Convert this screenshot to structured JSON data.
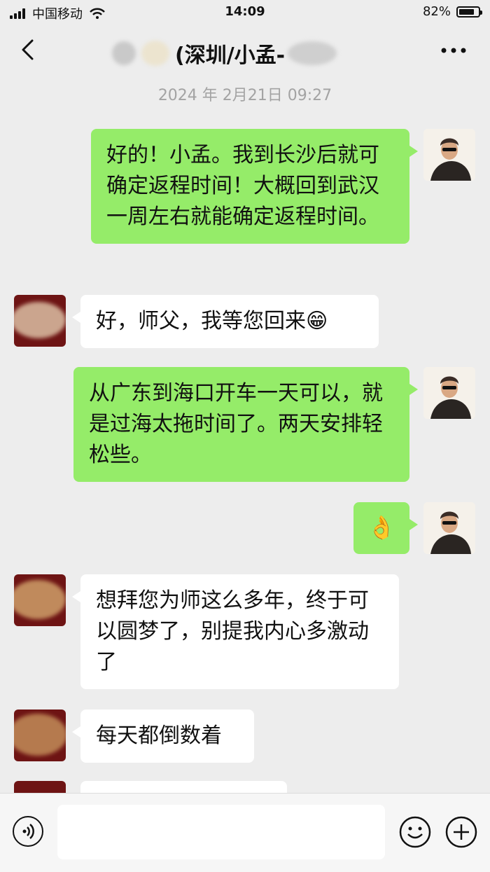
{
  "status": {
    "carrier": "中国移动",
    "time": "14:09",
    "battery": "82%",
    "battery_level": 0.82
  },
  "header": {
    "title": "(深圳/小孟-"
  },
  "timestamp": "2024 年 2月21日 09:27",
  "messages": [
    {
      "side": "out",
      "text": "好的！小孟。我到长沙后就可确定返程时间！大概回到武汉一周左右就能确定返程时间。"
    },
    {
      "side": "in",
      "text": "好，师父，我等您回来",
      "emoji": "😁"
    },
    {
      "side": "out",
      "text": "从广东到海口开车一天可以，就是过海太拖时间了。两天安排轻松些。"
    },
    {
      "side": "out",
      "emoji": "👌"
    },
    {
      "side": "in",
      "text": "想拜您为师这么多年，终于可以圆梦了，别提我内心多激动了"
    },
    {
      "side": "in",
      "text": "每天都倒数着"
    }
  ]
}
